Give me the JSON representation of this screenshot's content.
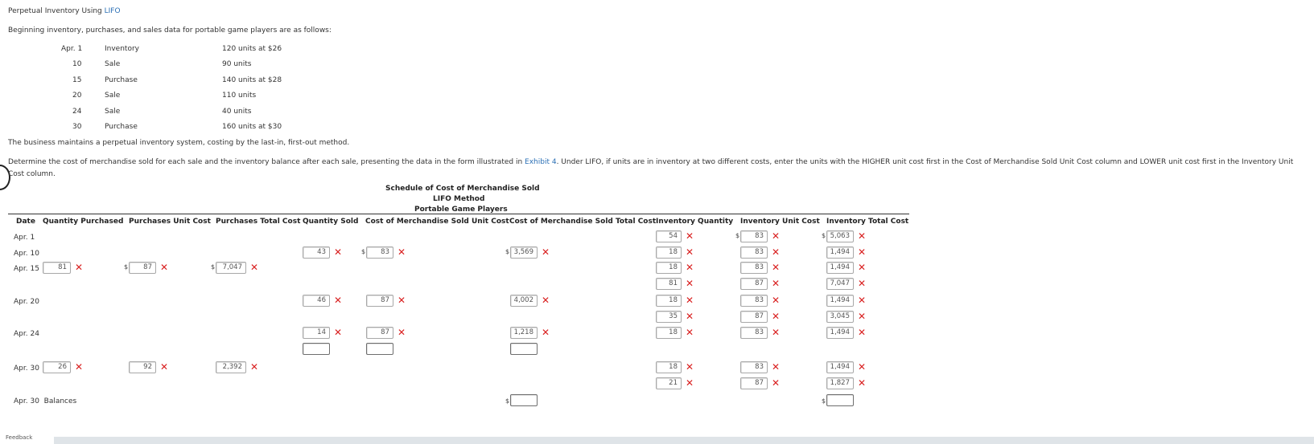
{
  "header": {
    "title_prefix": "Perpetual Inventory Using ",
    "title_link": "LIFO",
    "intro": "Beginning inventory, purchases, and sales data for portable game players are as follows:"
  },
  "events": [
    {
      "date": "Apr. 1",
      "type": "Inventory",
      "detail": "120 units at $26"
    },
    {
      "date": "10",
      "type": "Sale",
      "detail": "90 units"
    },
    {
      "date": "15",
      "type": "Purchase",
      "detail": "140 units at $28"
    },
    {
      "date": "20",
      "type": "Sale",
      "detail": "110 units"
    },
    {
      "date": "24",
      "type": "Sale",
      "detail": "40 units"
    },
    {
      "date": "30",
      "type": "Purchase",
      "detail": "160 units at $30"
    }
  ],
  "text": {
    "system_note": "The business maintains a perpetual inventory system, costing by the last-in, first-out method.",
    "instruction_1a": "Determine the cost of merchandise sold for each sale and the inventory balance after each sale, presenting the data in the form illustrated in ",
    "instruction_link": "Exhibit 4",
    "instruction_1b": ". Under LIFO, if units are in inventory at two different costs, enter the units with the HIGHER unit cost first in the Cost of Merchandise Sold Unit Cost column and LOWER unit cost first in the Inventory Unit",
    "instruction_2": "Cost column."
  },
  "schedule": {
    "title": "Schedule of Cost of Merchandise Sold",
    "method": "LIFO Method",
    "product": "Portable Game Players"
  },
  "columns": {
    "date": "Date",
    "qty_purchased": "Quantity Purchased",
    "purch_unit_cost": "Purchases Unit Cost",
    "purch_total_cost": "Purchases Total Cost",
    "qty_sold": "Quantity Sold",
    "cms_unit_cost": "Cost of Merchandise Sold Unit Cost",
    "cms_total_cost": "Cost of Merchandise Sold Total Cost",
    "inv_qty": "Inventory Quantity",
    "inv_unit_cost": "Inventory Unit Cost",
    "inv_total_cost": "Inventory Total Cost"
  },
  "rows": {
    "apr1": {
      "label": "Apr. 1",
      "inv_qty": "54",
      "inv_unit": "83",
      "inv_total": "5,063"
    },
    "apr10": {
      "label": "Apr. 10",
      "qty_sold": "43",
      "cms_unit": "83",
      "cms_total": "3,569",
      "inv_qty": "18",
      "inv_unit": "83",
      "inv_total": "1,494"
    },
    "apr15": {
      "label": "Apr. 15",
      "qty_purch": "81",
      "purch_unit": "87",
      "purch_total": "7,047",
      "inv_qty_1": "18",
      "inv_unit_1": "83",
      "inv_total_1": "1,494",
      "inv_qty_2": "81",
      "inv_unit_2": "87",
      "inv_total_2": "7,047"
    },
    "apr20": {
      "label": "Apr. 20",
      "qty_sold": "46",
      "cms_unit": "87",
      "cms_total": "4,002",
      "inv_qty_1": "18",
      "inv_unit_1": "83",
      "inv_total_1": "1,494",
      "inv_qty_2": "35",
      "inv_unit_2": "87",
      "inv_total_2": "3,045"
    },
    "apr24": {
      "label": "Apr. 24",
      "qty_sold_1": "14",
      "cms_unit_1": "87",
      "cms_total_1": "1,218",
      "qty_sold_2": "",
      "cms_unit_2": "",
      "cms_total_2": "",
      "inv_qty": "18",
      "inv_unit": "83",
      "inv_total": "1,494"
    },
    "apr30": {
      "label": "Apr. 30",
      "qty_purch": "26",
      "purch_unit": "92",
      "purch_total": "2,392",
      "inv_qty_1": "18",
      "inv_unit_1": "83",
      "inv_total_1": "1,494",
      "inv_qty_2": "21",
      "inv_unit_2": "87",
      "inv_total_2": "1,827"
    },
    "balances": {
      "label": "Apr. 30  Balances",
      "cms_total": "",
      "inv_total": ""
    }
  },
  "marks": {
    "incorrect": "✕",
    "dollar": "$"
  },
  "footer": {
    "feedback": "Feedback"
  },
  "colors": {
    "link": "#2a6fb5",
    "incorrect": "#d92020",
    "feedback_bar": "#dfe4e8"
  }
}
